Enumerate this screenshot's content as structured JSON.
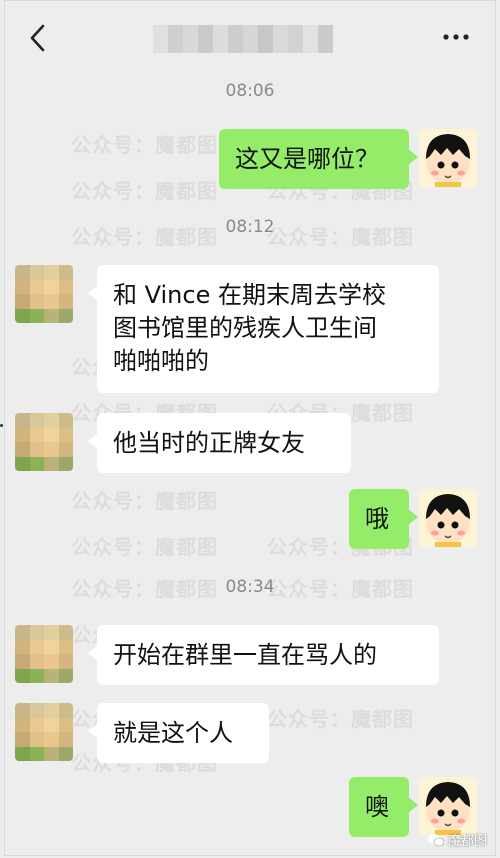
{
  "header": {
    "back_icon": "chevron-left-icon",
    "more_icon": "more-dots-icon"
  },
  "watermark_text": "公众号：魔都图",
  "messages": [
    {
      "type": "time",
      "text": "08:06"
    },
    {
      "type": "out",
      "text": "这又是哪位？"
    },
    {
      "type": "time",
      "text": "08:12"
    },
    {
      "type": "in",
      "lines": [
        "和 Vince 在期末周去学校",
        "图书馆里的残疾人卫生间",
        "啪啪啪的"
      ]
    },
    {
      "type": "in",
      "text": "他当时的正牌女友"
    },
    {
      "type": "out",
      "text": "哦"
    },
    {
      "type": "time",
      "text": "08:34"
    },
    {
      "type": "in",
      "text": "开始在群里一直在骂人的"
    },
    {
      "type": "in",
      "text": "就是这个人"
    },
    {
      "type": "out",
      "text": "噢"
    }
  ],
  "corner_mark": {
    "text": "魔都图",
    "icon": "wechat-logo-icon"
  },
  "colors": {
    "background": "#ededed",
    "outgoing_bubble": "#95ec69",
    "incoming_bubble": "#ffffff",
    "time_text": "#8a8a8a"
  }
}
